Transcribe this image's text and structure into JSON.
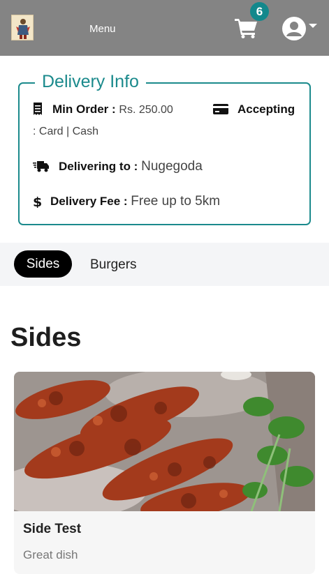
{
  "header": {
    "menu_label": "Menu",
    "cart_count": "6",
    "logo_icon": "restaurant-logo",
    "cart_icon": "shopping-cart-icon",
    "user_icon": "user-circle-icon",
    "accent_color": "#13888c",
    "bar_color": "#848484"
  },
  "delivery_info": {
    "title": "Delivery Info",
    "min_order_label": "Min Order :",
    "min_order_value": "Rs. 250.00",
    "accepting_label": "Accepting",
    "accepting_value": ": Card | Cash",
    "delivering_label": "Delivering to :",
    "delivering_value": "Nugegoda",
    "fee_label": "Delivery Fee :",
    "fee_value": "Free up to 5km"
  },
  "tabs": [
    {
      "label": "Sides",
      "active": true
    },
    {
      "label": "Burgers",
      "active": false
    }
  ],
  "section": {
    "title": "Sides",
    "items": [
      {
        "name": "Side Test",
        "description": "Great dish"
      }
    ]
  }
}
